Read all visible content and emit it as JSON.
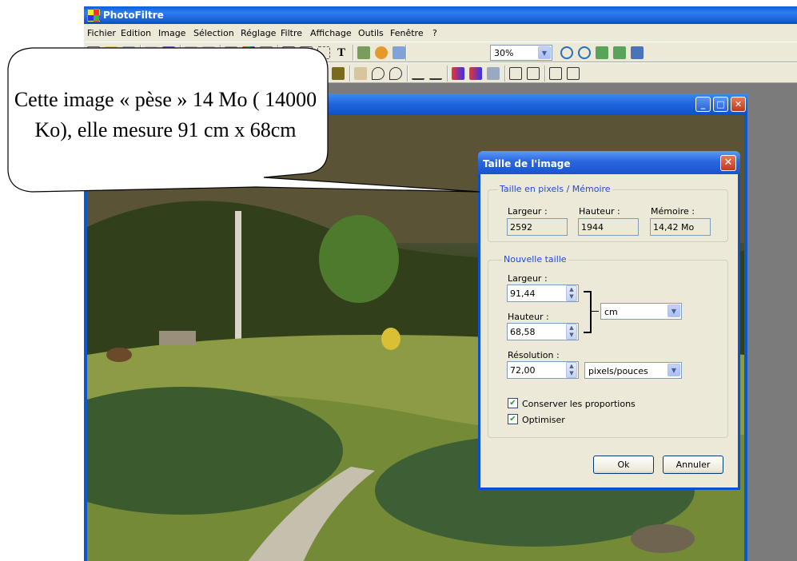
{
  "app": {
    "title": "PhotoFiltre"
  },
  "menu": [
    "Fichier",
    "Edition",
    "Image",
    "Sélection",
    "Réglage",
    "Filtre",
    "Affichage",
    "Outils",
    "Fenêtre",
    "?"
  ],
  "toolbar": {
    "zoom_value": "30%",
    "text_tool_glyph": "T"
  },
  "colors": {
    "xp_blue": "#0a4fd4",
    "face": "#ece9d8",
    "group_title": "#1c4bd8",
    "check": "#21a121"
  },
  "dialog": {
    "title": "Taille de l'image",
    "current_size_group": "Taille en pixels / Mémoire",
    "current": {
      "width_label": "Largeur :",
      "width": "2592",
      "height_label": "Hauteur :",
      "height": "1944",
      "memory_label": "Mémoire :",
      "memory": "14,42 Mo"
    },
    "new_size_group": "Nouvelle taille",
    "new": {
      "width_label": "Largeur :",
      "width": "91,44",
      "height_label": "Hauteur :",
      "height": "68,58",
      "unit": "cm",
      "resolution_label": "Résolution :",
      "resolution": "72,00",
      "resolution_unit": "pixels/pouces"
    },
    "keep_proportions": {
      "label": "Conserver les proportions",
      "checked": true
    },
    "optimize": {
      "label": "Optimiser",
      "checked": true
    },
    "ok_label": "Ok",
    "cancel_label": "Annuler"
  },
  "callout": {
    "text": "Cette image « pèse » 14 Mo ( 14000 Ko), elle mesure 91 cm x 68cm"
  }
}
